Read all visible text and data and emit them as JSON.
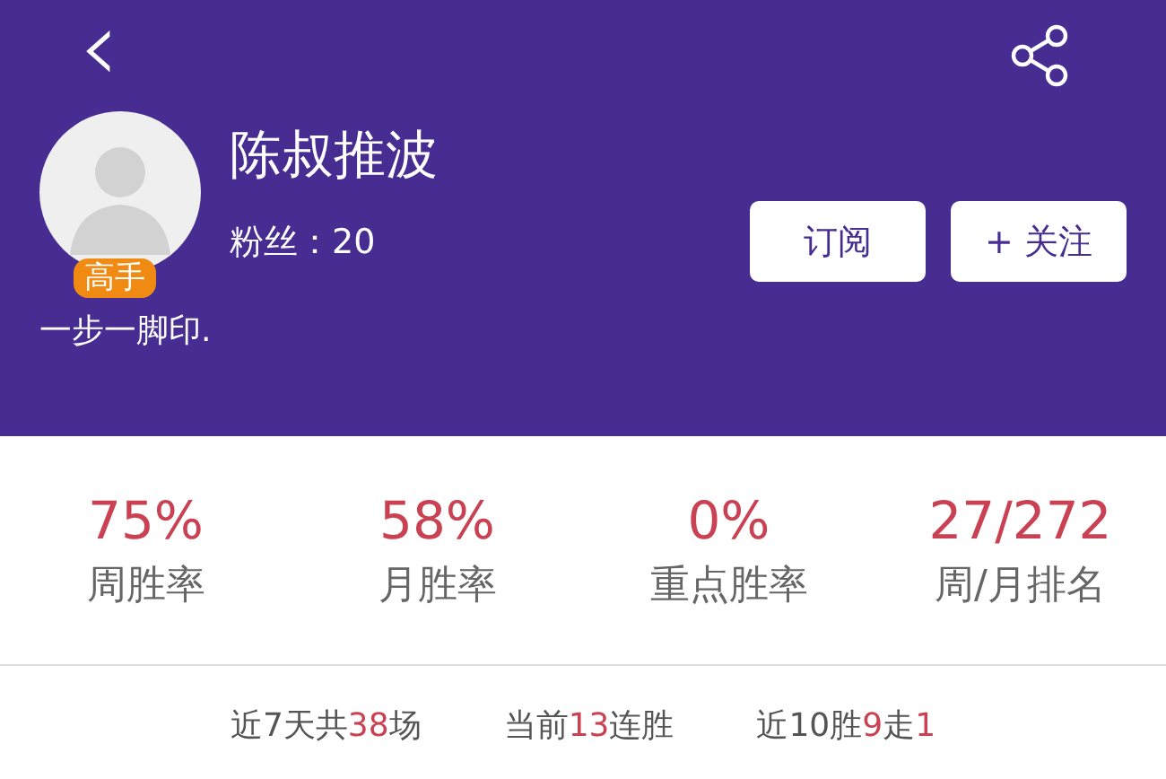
{
  "header": {
    "back_icon": "‹",
    "name": "陈叔推波",
    "badge": "高手",
    "followers_label": "粉丝：",
    "followers": "20",
    "motto": "一步一脚印.",
    "buttons": [
      {
        "label": "订阅"
      },
      {
        "label": "+ 关注"
      }
    ]
  },
  "stats": [
    {
      "value": "75%",
      "label": "周胜率"
    },
    {
      "value": "58%",
      "label": "月胜率"
    },
    {
      "value": "0%",
      "label": "重点胜率"
    },
    {
      "value": "27/272",
      "label": "周/月排名"
    }
  ],
  "summary": [
    [
      {
        "text": "近7天共",
        "highlight": false
      },
      {
        "text": "38",
        "highlight": true
      },
      {
        "text": "场",
        "highlight": false
      }
    ],
    [
      {
        "text": "当前",
        "highlight": false
      },
      {
        "text": "13",
        "highlight": true
      },
      {
        "text": "连胜",
        "highlight": false
      }
    ],
    [
      {
        "text": "近10胜",
        "highlight": false
      },
      {
        "text": "9",
        "highlight": true
      },
      {
        "text": "走",
        "highlight": false
      },
      {
        "text": "1",
        "highlight": true
      }
    ]
  ]
}
